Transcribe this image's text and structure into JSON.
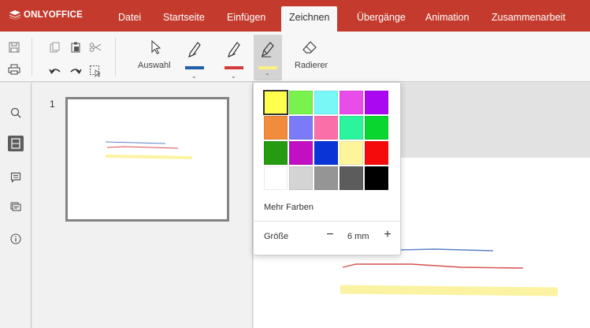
{
  "app": {
    "logo_text": "ONLYOFFICE"
  },
  "tabs": [
    {
      "label": "Datei"
    },
    {
      "label": "Startseite"
    },
    {
      "label": "Einfügen"
    },
    {
      "label": "Zeichnen",
      "active": true
    },
    {
      "label": "Übergänge"
    },
    {
      "label": "Animation"
    },
    {
      "label": "Zusammenarbeit"
    }
  ],
  "toolbar": {
    "select_label": "Auswahl",
    "eraser_label": "Radierer",
    "pens": [
      {
        "icon": "pen-icon",
        "color": "#1f5ea8"
      },
      {
        "icon": "pen-icon",
        "color": "#d63b3b"
      },
      {
        "icon": "highlighter-icon",
        "color": "#fcf080"
      }
    ]
  },
  "sidebar": {
    "items": [
      "search-icon",
      "slides-icon",
      "comments-icon",
      "chat-icon",
      "info-icon"
    ]
  },
  "slides": {
    "current_number": "1"
  },
  "color_popup": {
    "colors": [
      [
        "#ffff4d",
        "#79f24d",
        "#79f7f7",
        "#e94de9",
        "#a908f0"
      ],
      [
        "#f08c3b",
        "#7b7bf7",
        "#fb6fa8",
        "#2cf49c",
        "#09d62e"
      ],
      [
        "#249b10",
        "#c20fc4",
        "#0a34d6",
        "#fdf59b",
        "#f50b0b"
      ],
      [
        "#ffffff",
        "#d4d4d4",
        "#959595",
        "#5c5c5c",
        "#000000"
      ]
    ],
    "selected": "#ffff4d",
    "more_colors_label": "Mehr Farben",
    "size_label": "Größe",
    "size_value": "6 mm",
    "minus_symbol": "−",
    "plus_symbol": "+"
  },
  "colors": {
    "accent": "#c43b2e",
    "stroke_blue": "#5b82c4",
    "stroke_red": "#d6504c",
    "stroke_yellow": "#fbf3a1"
  }
}
